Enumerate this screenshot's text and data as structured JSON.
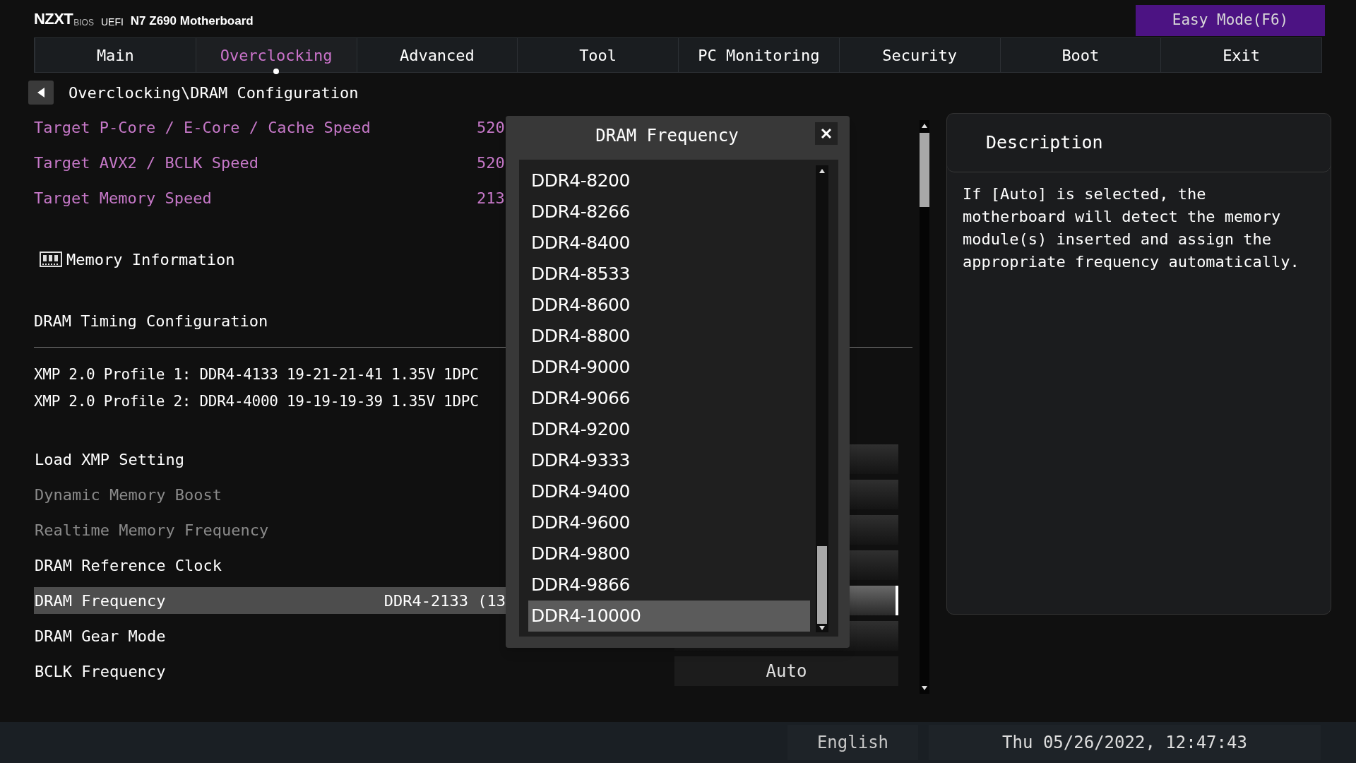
{
  "header": {
    "brand": "NZXT",
    "brand_sub": "BIOS",
    "firmware": "UEFI",
    "model": "N7 Z690 Motherboard",
    "easy_mode": "Easy Mode(F6)"
  },
  "tabs": [
    {
      "label": "Main",
      "selected": false
    },
    {
      "label": "Overclocking",
      "selected": true
    },
    {
      "label": "Advanced",
      "selected": false
    },
    {
      "label": "Tool",
      "selected": false
    },
    {
      "label": "PC Monitoring",
      "selected": false
    },
    {
      "label": "Security",
      "selected": false
    },
    {
      "label": "Boot",
      "selected": false
    },
    {
      "label": "Exit",
      "selected": false
    }
  ],
  "breadcrumb": "Overclocking\\DRAM Configuration",
  "targets": [
    {
      "label": "Target P-Core / E-Core / Cache Speed",
      "value": "520"
    },
    {
      "label": "Target AVX2 / BCLK Speed",
      "value": "520"
    },
    {
      "label": "Target Memory Speed",
      "value": "213"
    }
  ],
  "memory_information": "Memory Information",
  "section_title": "DRAM Timing Configuration",
  "xmp_profiles": [
    "XMP 2.0 Profile 1: DDR4-4133 19-21-21-41 1.35V 1DPC",
    "XMP 2.0 Profile 2: DDR4-4000 19-19-19-39 1.35V 1DPC"
  ],
  "settings": [
    {
      "label": "Load XMP Setting",
      "disabled": false,
      "selected": false
    },
    {
      "label": "Dynamic Memory Boost",
      "disabled": true,
      "selected": false
    },
    {
      "label": "Realtime Memory Frequency",
      "disabled": true,
      "selected": false
    },
    {
      "label": "DRAM Reference Clock",
      "disabled": false,
      "selected": false
    },
    {
      "label": "DRAM Frequency",
      "disabled": false,
      "selected": true,
      "value": "DDR4-2133 (13"
    },
    {
      "label": "DRAM Gear Mode",
      "disabled": false,
      "selected": false
    },
    {
      "label": "BCLK Frequency",
      "disabled": false,
      "selected": false,
      "box_value": "Auto"
    }
  ],
  "popup": {
    "title": "DRAM Frequency",
    "options": [
      {
        "label": "DDR4-8200",
        "selected": false
      },
      {
        "label": "DDR4-8266",
        "selected": false
      },
      {
        "label": "DDR4-8400",
        "selected": false
      },
      {
        "label": "DDR4-8533",
        "selected": false
      },
      {
        "label": "DDR4-8600",
        "selected": false
      },
      {
        "label": "DDR4-8800",
        "selected": false
      },
      {
        "label": "DDR4-9000",
        "selected": false
      },
      {
        "label": "DDR4-9066",
        "selected": false
      },
      {
        "label": "DDR4-9200",
        "selected": false
      },
      {
        "label": "DDR4-9333",
        "selected": false
      },
      {
        "label": "DDR4-9400",
        "selected": false
      },
      {
        "label": "DDR4-9600",
        "selected": false
      },
      {
        "label": "DDR4-9800",
        "selected": false
      },
      {
        "label": "DDR4-9866",
        "selected": false
      },
      {
        "label": "DDR4-10000",
        "selected": true
      }
    ]
  },
  "description": {
    "title": "Description",
    "text": "If [Auto] is selected, the motherboard will detect the memory module(s) inserted and assign the appropriate frequency automatically."
  },
  "footer": {
    "language": "English",
    "datetime": "Thu 05/26/2022, 12:47:43"
  }
}
